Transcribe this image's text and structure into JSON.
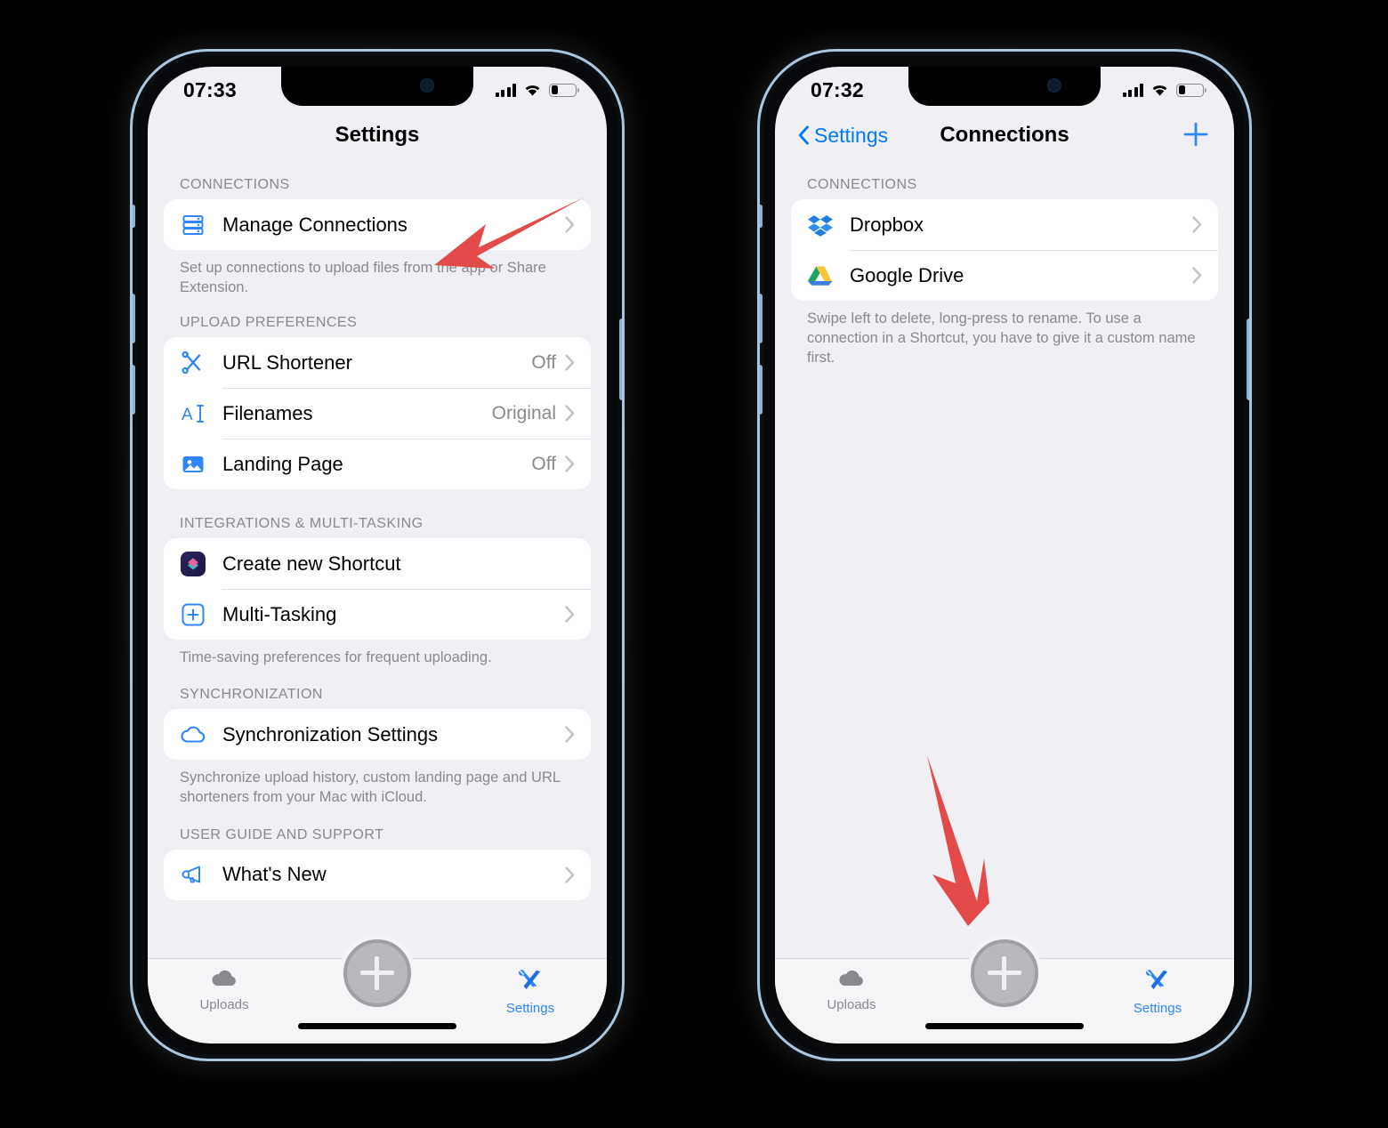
{
  "phones": [
    {
      "id": "phone-settings",
      "status": {
        "time": "07:33",
        "signal_icon": "cellular-bars-icon",
        "wifi_icon": "wifi-icon",
        "battery_icon": "battery-icon",
        "battery_percent": 30
      },
      "nav": {
        "title": "Settings",
        "back_label": null,
        "plus_label": null
      },
      "groups": [
        {
          "header": "CONNECTIONS",
          "rows": [
            {
              "icon": "server-rack-icon",
              "label": "Manage Connections",
              "value": null,
              "chevron": true
            }
          ],
          "footer": "Set up connections to upload files from the app or Share Extension."
        },
        {
          "header": "UPLOAD PREFERENCES",
          "rows": [
            {
              "icon": "scissors-icon",
              "label": "URL Shortener",
              "value": "Off",
              "chevron": true
            },
            {
              "icon": "text-cursor-icon",
              "label": "Filenames",
              "value": "Original",
              "chevron": true
            },
            {
              "icon": "photo-icon",
              "label": "Landing Page",
              "value": "Off",
              "chevron": true
            }
          ],
          "footer": ""
        },
        {
          "header": "INTEGRATIONS & MULTI-TASKING",
          "rows": [
            {
              "icon": "shortcuts-app-icon",
              "label": "Create new Shortcut",
              "value": null,
              "chevron": false
            },
            {
              "icon": "plus-square-icon",
              "label": "Multi-Tasking",
              "value": null,
              "chevron": true
            }
          ],
          "footer": "Time-saving preferences for frequent uploading."
        },
        {
          "header": "SYNCHRONIZATION",
          "rows": [
            {
              "icon": "cloud-icon",
              "label": "Synchronization Settings",
              "value": null,
              "chevron": true
            }
          ],
          "footer": "Synchronize upload history, custom landing page and URL shorteners from your Mac with iCloud."
        },
        {
          "header": "USER GUIDE AND SUPPORT",
          "rows": [
            {
              "icon": "megaphone-icon",
              "label": "What's New",
              "value": null,
              "chevron": true
            }
          ],
          "footer": ""
        }
      ],
      "tabs": [
        {
          "icon": "cloud-icon",
          "label": "Uploads",
          "active": false
        },
        {
          "icon": "plus-circle-icon",
          "label": "",
          "active": false
        },
        {
          "icon": "tools-icon",
          "label": "Settings",
          "active": true
        }
      ]
    },
    {
      "id": "phone-connections",
      "status": {
        "time": "07:32",
        "signal_icon": "cellular-bars-icon",
        "wifi_icon": "wifi-icon",
        "battery_icon": "battery-icon",
        "battery_percent": 30
      },
      "nav": {
        "title": "Connections",
        "back_label": "Settings",
        "plus_label": "+"
      },
      "groups": [
        {
          "header": "CONNECTIONS",
          "rows": [
            {
              "icon": "dropbox-icon",
              "label": "Dropbox",
              "value": null,
              "chevron": true
            },
            {
              "icon": "google-drive-icon",
              "label": "Google Drive",
              "value": null,
              "chevron": true
            }
          ],
          "footer": "Swipe left to delete, long-press to rename. To use a connection in a Shortcut, you have to give it a custom name first."
        }
      ],
      "tabs": [
        {
          "icon": "cloud-icon",
          "label": "Uploads",
          "active": false
        },
        {
          "icon": "plus-circle-icon",
          "label": "",
          "active": false
        },
        {
          "icon": "tools-icon",
          "label": "Settings",
          "active": true
        }
      ]
    }
  ],
  "annotations": [
    {
      "name": "arrow-to-manage-connections",
      "color": "#E34B4B",
      "direction": "down-left"
    },
    {
      "name": "arrow-to-add-button",
      "color": "#E34B4B",
      "direction": "down"
    }
  ],
  "colors": {
    "accent_blue": "#007aff",
    "tint_blue": "#2f86f6",
    "background": "#efeff4",
    "card": "#ffffff",
    "secondary_text": "#8a8a8e",
    "arrow_red": "#E34B4B",
    "frame": "#a9c6e0"
  }
}
